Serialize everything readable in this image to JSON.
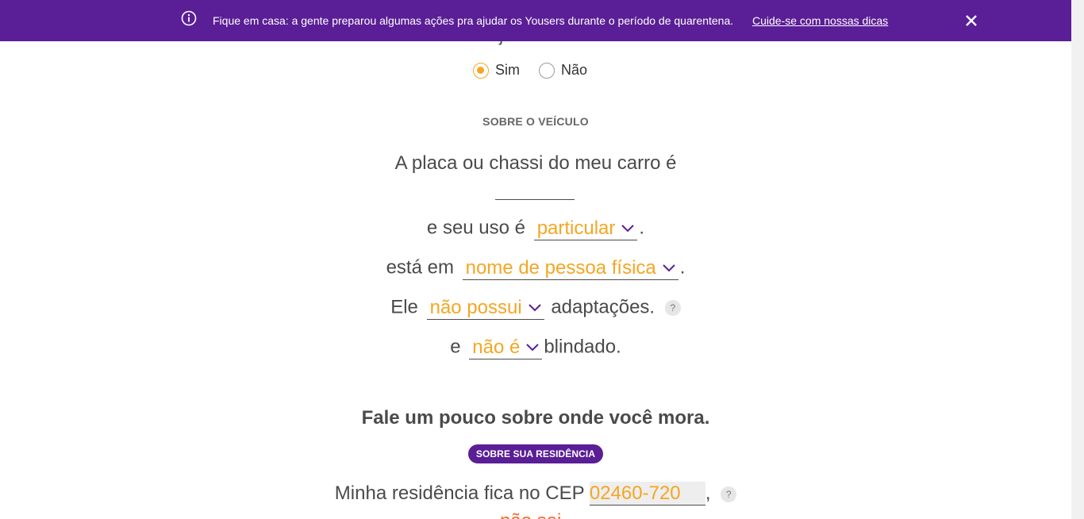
{
  "banner": {
    "message": "Fique em casa: a gente preparou algumas ações pra ajudar os Yousers durante o período de quarentena.",
    "link": "Cuide-se com nossas dicas",
    "bg_color": "#5a1e96"
  },
  "form": {
    "question_cut": "Você já tem o carro?",
    "radio_yes": "Sim",
    "radio_no": "Não",
    "radio_selected": "Sim",
    "section_vehicle": "SOBRE O VEÍCULO",
    "plate_label": "A placa ou chassi do meu carro é",
    "plate_value": "",
    "usage_prefix": "e seu uso é",
    "usage_value": "particular",
    "usage_suffix": ".",
    "owner_prefix": "está em",
    "owner_value": "nome de pessoa física",
    "owner_suffix": ".",
    "adapt_prefix": "Ele",
    "adapt_value": "não possui",
    "adapt_suffix": "adaptações.",
    "armor_prefix": "e",
    "armor_value": "não é",
    "armor_suffix": "blindado.",
    "help_glyph": "?",
    "residence_heading": "Fale um pouco sobre onde você mora.",
    "residence_pill": "SOBRE SUA RESIDÊNCIA",
    "cep_label": "Minha residência fica no CEP",
    "cep_value": "02460-720",
    "cep_suffix": ",",
    "partial_next": "não sei"
  },
  "colors": {
    "accent": "#f5a623",
    "purple": "#5a1e96",
    "text": "#4a4a4a"
  }
}
